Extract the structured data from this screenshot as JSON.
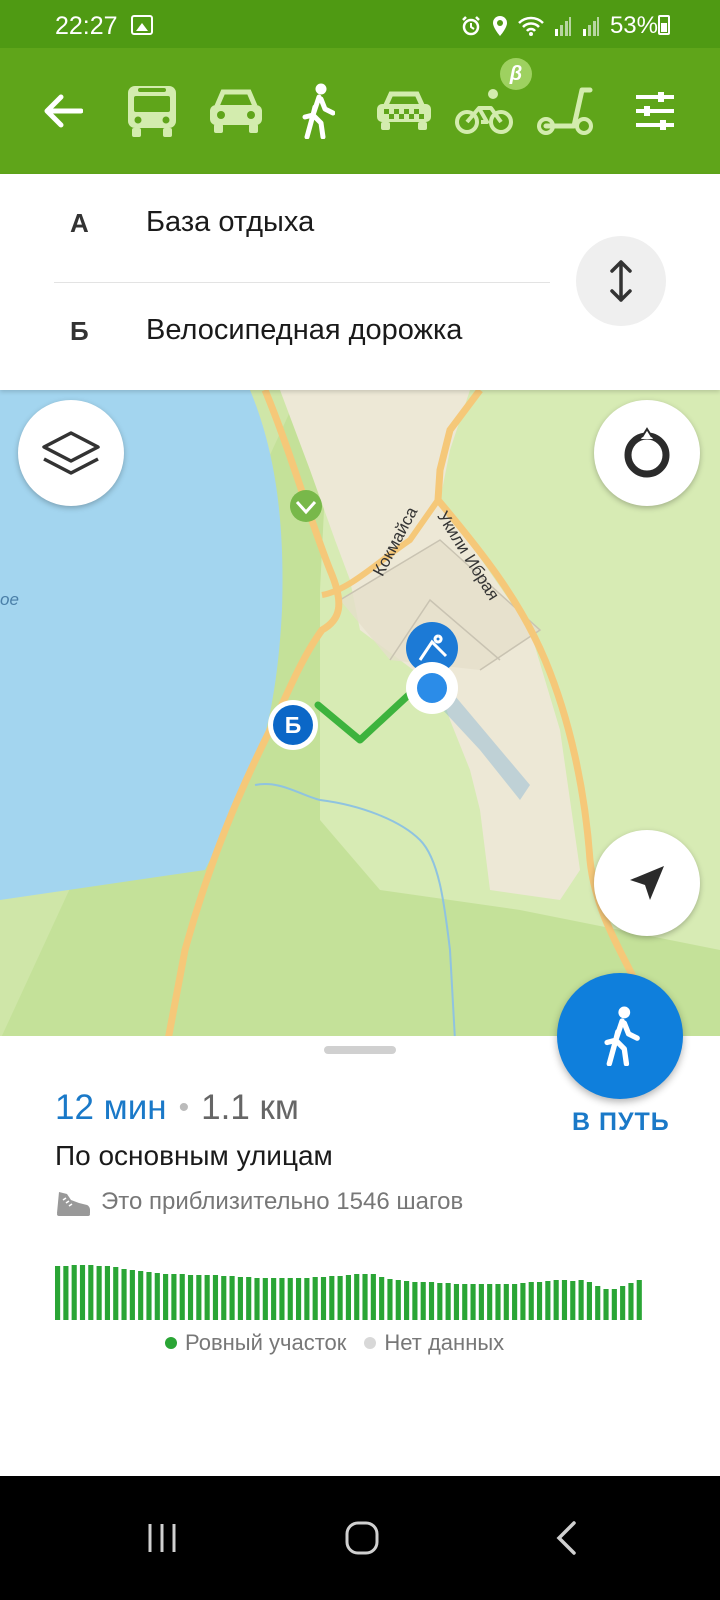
{
  "status_bar": {
    "time": "22:27",
    "battery_percent": "53%"
  },
  "toolbar": {
    "modes": [
      "back",
      "bus",
      "car",
      "walk",
      "taxi",
      "bike",
      "scooter",
      "settings"
    ],
    "active_mode": "walk",
    "beta_label": "β",
    "accent": "#5fa51a"
  },
  "route_points": {
    "a": {
      "letter": "А",
      "name": "База отдыха"
    },
    "b": {
      "letter": "Б",
      "name": "Велосипедная дорожка"
    }
  },
  "map": {
    "street_labels": [
      "Кокмайса",
      "Укили Ибрая"
    ],
    "lake_label_fragment": "ое",
    "marker_b_letter": "Б"
  },
  "route_summary": {
    "time": "12 мин",
    "separator": "•",
    "distance": "1.1 км",
    "description": "По основным улицам",
    "steps_text": "Это приблизительно 1546 шагов",
    "go_label": "В ПУТЬ"
  },
  "elevation": {
    "bars": [
      54,
      54,
      55,
      55,
      55,
      54,
      54,
      53,
      51,
      50,
      49,
      48,
      47,
      46,
      46,
      46,
      45,
      45,
      45,
      45,
      44,
      44,
      43,
      43,
      42,
      42,
      42,
      42,
      42,
      42,
      42,
      43,
      43,
      44,
      44,
      45,
      46,
      46,
      46,
      43,
      41,
      40,
      39,
      38,
      38,
      38,
      37,
      37,
      36,
      36,
      36,
      36,
      36,
      36,
      36,
      36,
      37,
      38,
      38,
      39,
      40,
      40,
      39,
      40,
      38,
      34,
      31,
      31,
      34,
      37,
      40
    ],
    "color": "#2aa535",
    "legend": [
      {
        "label": "Ровный участок",
        "color": "#2aa535"
      },
      {
        "label": "Нет данных",
        "color": "#d8d8d8"
      }
    ]
  }
}
